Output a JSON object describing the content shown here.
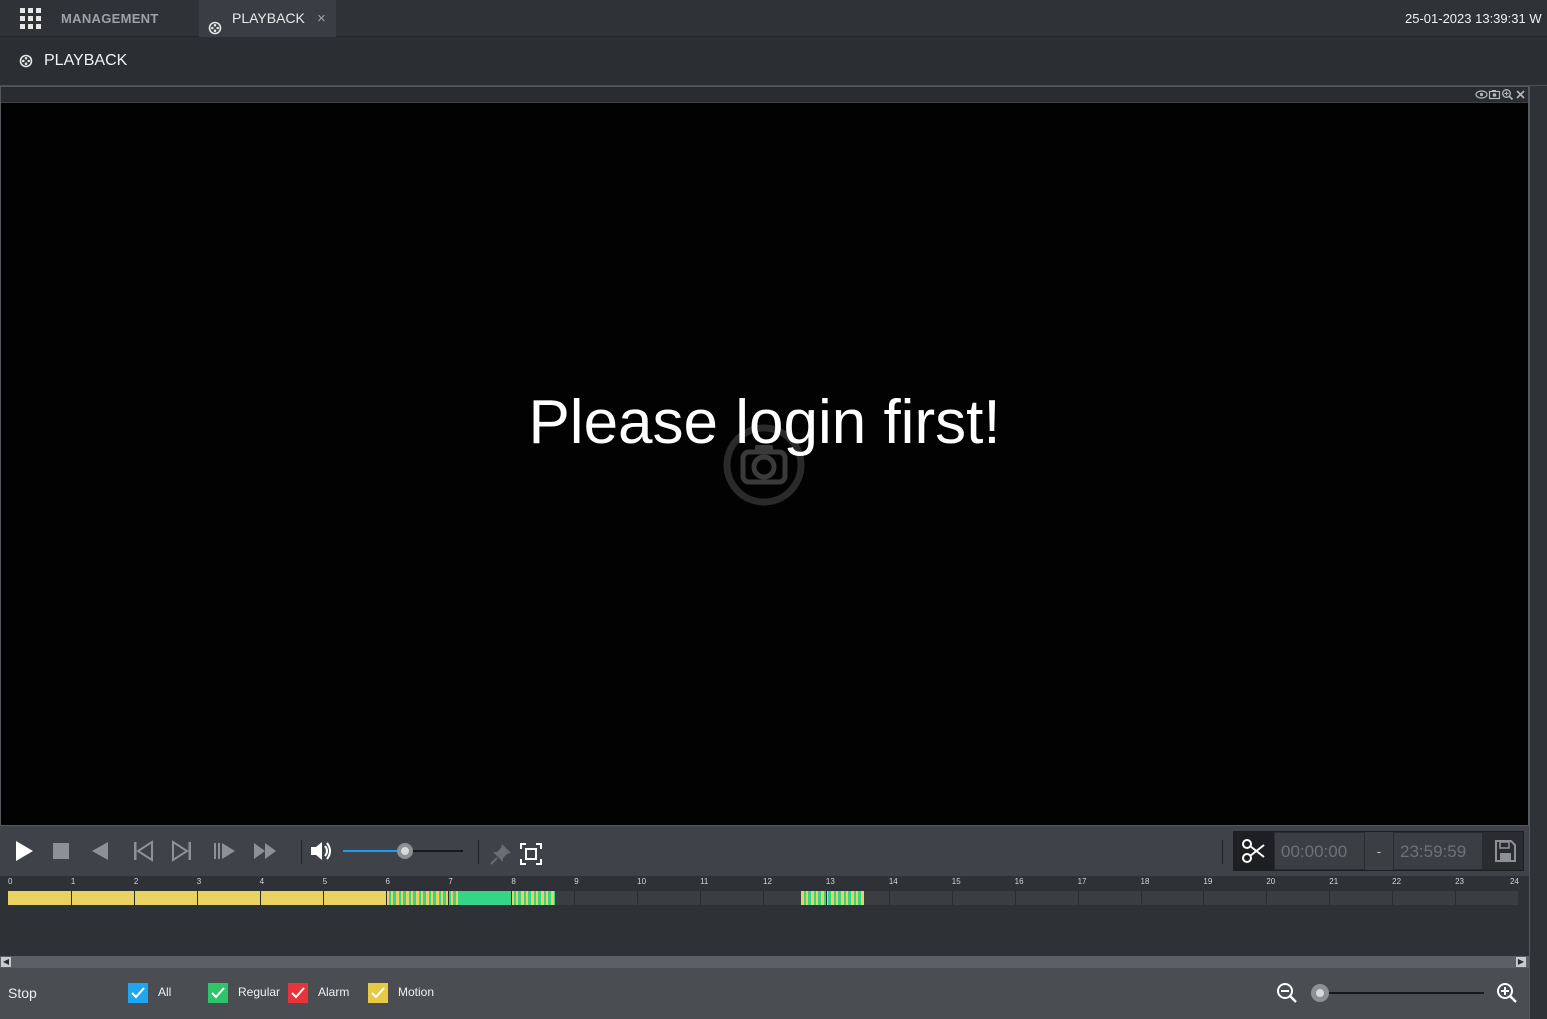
{
  "topbar": {
    "management_tab": "MANAGEMENT",
    "playback_tab": "PLAYBACK",
    "close_glyph": "×",
    "datetime": "25-01-2023 13:39:31 W"
  },
  "page": {
    "title": "PLAYBACK"
  },
  "video": {
    "message": "Please login first!",
    "toolbar_icons": [
      "eye-icon",
      "camera-icon",
      "zoom-icon",
      "close-icon"
    ]
  },
  "controls": {
    "icons": [
      "play-icon",
      "stop-icon",
      "reverse-play-icon",
      "previous-frame-icon",
      "next-frame-icon",
      "slow-play-icon",
      "fast-forward-icon",
      "volume-icon",
      "pin-icon",
      "fullscreen-icon"
    ],
    "volume_level": 0.52,
    "clip_start": "00:00:00",
    "clip_separator": "-",
    "clip_end": "23:59:59"
  },
  "timeline": {
    "hours": [
      "0",
      "1",
      "2",
      "3",
      "4",
      "5",
      "6",
      "7",
      "8",
      "9",
      "10",
      "11",
      "12",
      "13",
      "14",
      "15",
      "16",
      "17",
      "18",
      "19",
      "20",
      "21",
      "22",
      "23",
      "24"
    ],
    "recordings": [
      {
        "start": 0.0,
        "end": 6.0,
        "type": "motion"
      },
      {
        "start": 6.0,
        "end": 7.15,
        "type": "mixed"
      },
      {
        "start": 7.15,
        "end": 8.0,
        "type": "regular"
      },
      {
        "start": 8.0,
        "end": 8.7,
        "type": "mixed"
      },
      {
        "start": 12.6,
        "end": 13.6,
        "type": "mixed"
      }
    ]
  },
  "bottombar": {
    "status": "Stop",
    "legend": [
      {
        "label": "All",
        "color": "#1ea7f0"
      },
      {
        "label": "Regular",
        "color": "#2ec46a"
      },
      {
        "label": "Alarm",
        "color": "#e8333a"
      },
      {
        "label": "Motion",
        "color": "#e8c943"
      }
    ],
    "zoom_level": 0.0
  },
  "colors": {
    "motion": "#e9d261",
    "regular": "#36d486",
    "accent": "#1e9bf0"
  }
}
